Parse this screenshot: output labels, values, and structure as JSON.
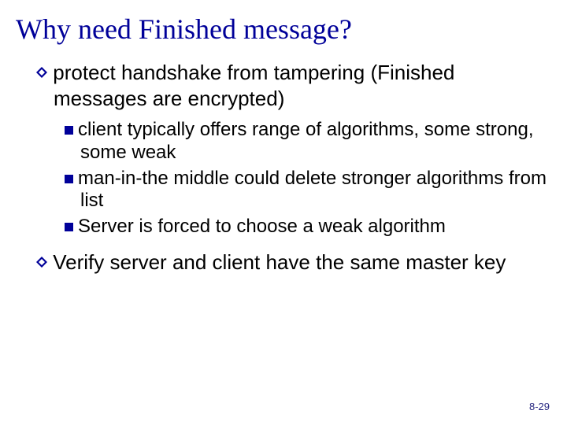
{
  "title": "Why need Finished message?",
  "bullets": {
    "b1": "protect handshake from tampering (Finished messages are encrypted)",
    "b1_sub": {
      "s1": "client typically offers range of algorithms, some strong, some weak",
      "s2": "man-in-the middle could delete stronger algorithms from list",
      "s3": "Server is forced to choose a weak algorithm"
    },
    "b2": "Verify server and client have the same master key"
  },
  "page_number": "8-29"
}
